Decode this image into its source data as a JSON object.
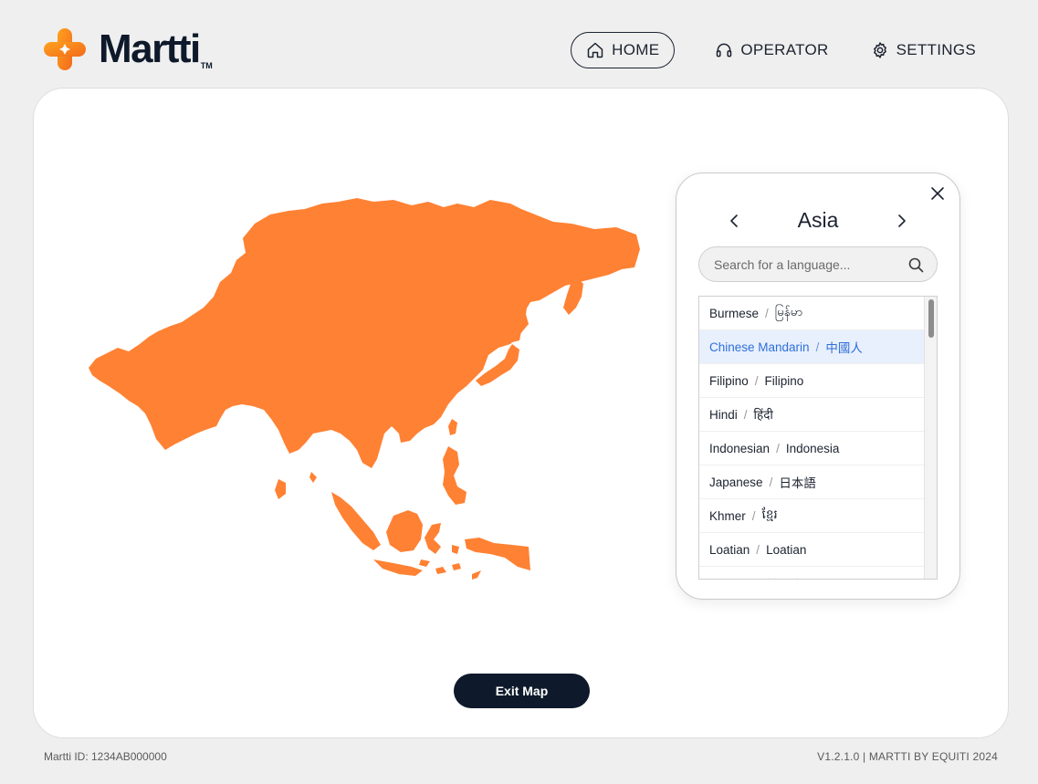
{
  "brand": {
    "name": "Martti",
    "trademark": "TM",
    "accent": "#f5871f"
  },
  "nav": {
    "home": "HOME",
    "operator": "OPERATOR",
    "settings": "SETTINGS",
    "active": "home"
  },
  "region_card": {
    "region": "Asia",
    "search_placeholder": "Search for a language...",
    "languages": [
      {
        "name": "Burmese",
        "native": "မြန်မာ",
        "selected": false
      },
      {
        "name": "Chinese Mandarin",
        "native": "中國人",
        "selected": true
      },
      {
        "name": "Filipino",
        "native": "Filipino",
        "selected": false
      },
      {
        "name": "Hindi",
        "native": "हिंदी",
        "selected": false
      },
      {
        "name": "Indonesian",
        "native": "Indonesia",
        "selected": false
      },
      {
        "name": "Japanese",
        "native": "日本語",
        "selected": false
      },
      {
        "name": "Khmer",
        "native": "ខ្មែរ",
        "selected": false
      },
      {
        "name": "Loatian",
        "native": "Loatian",
        "selected": false
      },
      {
        "name": "Korean",
        "native": "한국어",
        "selected": false
      }
    ],
    "selected_color": "#2f6fd8",
    "selected_bg": "#e8f0fd"
  },
  "map": {
    "region": "Asia",
    "fill": "#ff8133"
  },
  "actions": {
    "exit_map": "Exit Map"
  },
  "footer": {
    "device_id": "Martti ID: 1234AB000000",
    "version": "V1.2.1.0  |  MARTTI BY EQUITI 2024"
  }
}
